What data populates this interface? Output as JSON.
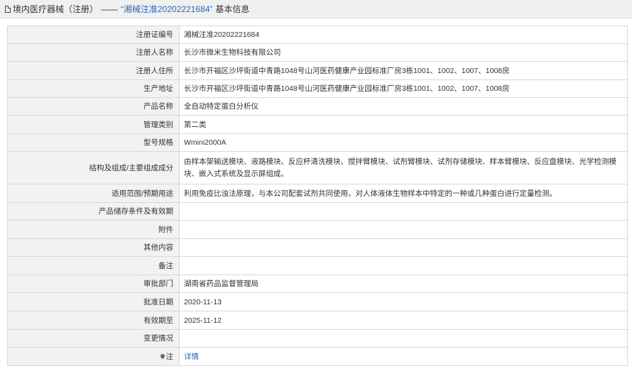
{
  "header": {
    "icon": "document-icon",
    "category": "境内医疗器械（注册）",
    "dash": "——",
    "reg_title": "“湘械注准20202221684”",
    "suffix": "基本信息"
  },
  "rows": [
    {
      "label": "注册证编号",
      "value": "湘械注准20202221684"
    },
    {
      "label": "注册人名称",
      "value": "长沙市微米生物科技有限公司"
    },
    {
      "label": "注册人住所",
      "value": "长沙市开福区沙坪街道中青路1048号山河医药健康产业园标准厂房3栋1001、1002、1007、1008房"
    },
    {
      "label": "生产地址",
      "value": "长沙市开福区沙坪街道中青路1048号山河医药健康产业园标准厂房3栋1001、1002、1007、1008房"
    },
    {
      "label": "产品名称",
      "value": "全自动特定蛋白分析仪"
    },
    {
      "label": "管理类别",
      "value": "第二类"
    },
    {
      "label": "型号规格",
      "value": "Wmini2000A"
    },
    {
      "label": "结构及组成/主要组成成分",
      "value": "由样本架输送模块、液路模块、反应杯清洗模块、搅拌臂模块、试剂臂模块、试剂存储模块、样本臂模块、反应盘模块、光学检测模块、嵌入式系统及显示屏组成。"
    },
    {
      "label": "适用范围/预期用途",
      "value": "利用免疫比浊法原理，与本公司配套试剂共同使用，对人体液体生物样本中特定的一种或几种蛋白进行定量检测。"
    },
    {
      "label": "产品储存条件及有效期",
      "value": ""
    },
    {
      "label": "附件",
      "value": ""
    },
    {
      "label": "其他内容",
      "value": ""
    },
    {
      "label": "备注",
      "value": ""
    },
    {
      "label": "审批部门",
      "value": "湖南省药品监督管理局"
    },
    {
      "label": "批准日期",
      "value": "2020-11-13"
    },
    {
      "label": "有效期至",
      "value": "2025-11-12"
    },
    {
      "label": "变更情况",
      "value": ""
    }
  ],
  "note_row": {
    "label": "注",
    "icon": "pin-icon",
    "link_text": "详情"
  },
  "colors": {
    "accent": "#2b67b8",
    "label_bg": "#f2f2f2",
    "border": "#d8d8d8"
  }
}
